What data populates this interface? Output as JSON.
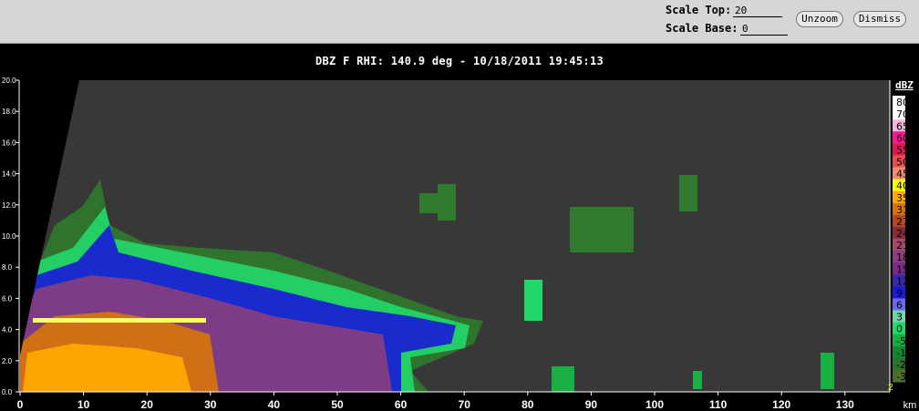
{
  "toolbar": {
    "scale_top_label": "Scale Top:",
    "scale_top_value": "20",
    "scale_base_label": "Scale Base:",
    "scale_base_value": "0",
    "unzoom_label": "Unzoom",
    "dismiss_label": "Dismiss"
  },
  "display": {
    "title": "DBZ F  RHI: 140.9 deg  -  10/18/2011 19:45:13",
    "corner_marker": "2"
  },
  "axes": {
    "x_unit": "km",
    "x_ticks": [
      "0",
      "10",
      "20",
      "30",
      "40",
      "50",
      "60",
      "70",
      "80",
      "90",
      "100",
      "110",
      "120",
      "130"
    ],
    "y_ticks": [
      "0.0",
      "2.0",
      "4.0",
      "6.0",
      "8.0",
      "10.0",
      "12.0",
      "14.0",
      "16.0",
      "18.0",
      "20.0"
    ]
  },
  "legend": {
    "unit": "dBZ",
    "entries": [
      {
        "label": "80",
        "color": "#ffffff"
      },
      {
        "label": "70",
        "color": "#ffffff"
      },
      {
        "label": "65",
        "color": "#f2b6dc"
      },
      {
        "label": "60",
        "color": "#ff1493"
      },
      {
        "label": "55",
        "color": "#e0194f"
      },
      {
        "label": "50",
        "color": "#e84d50"
      },
      {
        "label": "45",
        "color": "#f08a70"
      },
      {
        "label": "40",
        "color": "#ffff00"
      },
      {
        "label": "35",
        "color": "#ffaa00"
      },
      {
        "label": "31",
        "color": "#d8740a"
      },
      {
        "label": "27",
        "color": "#b24c1c"
      },
      {
        "label": "24",
        "color": "#8a2a3a"
      },
      {
        "label": "21",
        "color": "#a64a6a"
      },
      {
        "label": "18",
        "color": "#8a3e7e"
      },
      {
        "label": "15",
        "color": "#7a2b8a"
      },
      {
        "label": "12",
        "color": "#3a2aa8"
      },
      {
        "label": "9",
        "color": "#1a1ad8"
      },
      {
        "label": "6",
        "color": "#6a6aee"
      },
      {
        "label": "3",
        "color": "#6ed6a8"
      },
      {
        "label": "0",
        "color": "#22d86a"
      },
      {
        "label": "-5",
        "color": "#18b045"
      },
      {
        "label": "-10",
        "color": "#128a32"
      },
      {
        "label": "-20",
        "color": "#2e6e2e"
      },
      {
        "label": "-30",
        "color": "#4c6e2a"
      }
    ]
  }
}
